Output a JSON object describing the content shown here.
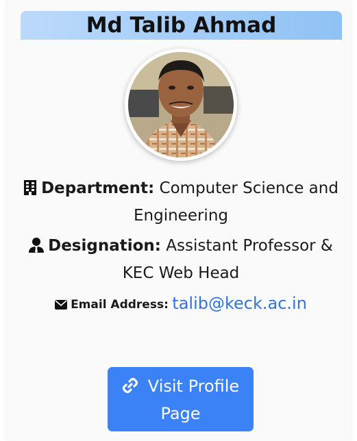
{
  "profile": {
    "name": "Md Talib Ahmad",
    "department_label": "Department:",
    "department_value": "Computer Science and Engineering",
    "designation_label": "Designation:",
    "designation_value": "Assistant Professor & KEC Web Head",
    "email_label": "Email Address:",
    "email_value": "talib@keck.ac.in"
  },
  "button": {
    "label": "Visit Profile Page"
  },
  "icons": {
    "department": "building-icon",
    "designation": "user-tie-icon",
    "email": "envelope-icon",
    "button": "link-icon"
  },
  "colors": {
    "header_gradient_start": "#bcd9fb",
    "header_gradient_end": "#8fc2f4",
    "button_bg": "#3b82f6",
    "link": "#3273dc"
  }
}
